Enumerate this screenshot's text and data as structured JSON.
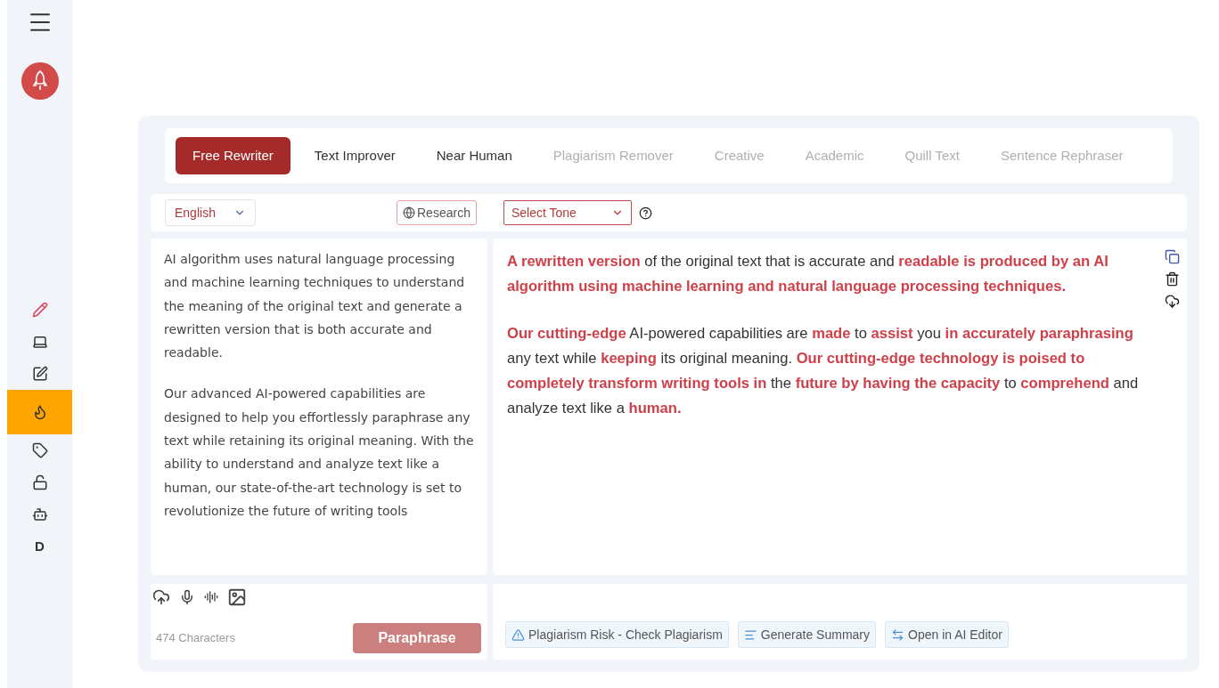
{
  "sidebar": {
    "items": [
      {
        "kind": "pencil",
        "selected": false
      },
      {
        "kind": "laptop",
        "selected": false
      },
      {
        "kind": "edit",
        "selected": false
      },
      {
        "kind": "flame",
        "selected": true
      },
      {
        "kind": "tag",
        "selected": false
      },
      {
        "kind": "unlock",
        "selected": false
      },
      {
        "kind": "robot",
        "selected": false
      },
      {
        "kind": "letter",
        "label": "D",
        "selected": false
      }
    ]
  },
  "tabs": [
    {
      "label": "Free Rewriter",
      "selected": true,
      "disabled": false
    },
    {
      "label": "Text Improver",
      "selected": false,
      "disabled": false
    },
    {
      "label": "Near Human",
      "selected": false,
      "disabled": false
    },
    {
      "label": "Plagiarism Remover",
      "selected": false,
      "disabled": true
    },
    {
      "label": "Creative",
      "selected": false,
      "disabled": true
    },
    {
      "label": "Academic",
      "selected": false,
      "disabled": true
    },
    {
      "label": "Quill Text",
      "selected": false,
      "disabled": true
    },
    {
      "label": "Sentence Rephraser",
      "selected": false,
      "disabled": true
    }
  ],
  "toolbar": {
    "language": "English",
    "research_button": "Research",
    "tone": {
      "placeholder": "Select Tone"
    }
  },
  "input": {
    "paragraphs": [
      "AI algorithm uses natural language processing and machine learning techniques to understand the meaning of the original text and generate a rewritten version that is both accurate and readable.",
      "Our advanced AI-powered capabilities are designed to help you effortlessly paraphrase any text while retaining its original meaning. With the ability to understand and analyze text like a human, our state-of-the-art technology is set to revolutionize the future of writing tools"
    ],
    "character_count": "474 Characters",
    "paraphrase_button": "Paraphrase"
  },
  "output": {
    "paragraphs": [
      [
        {
          "text": "A rewritten version",
          "changed": true
        },
        {
          "text": " of the original text that is accurate and ",
          "changed": false
        },
        {
          "text": "readable is produced by an AI algorithm using machine learning and natural language processing techniques.",
          "changed": true
        }
      ],
      [
        {
          "text": "Our cutting-edge",
          "changed": true
        },
        {
          "text": " AI-powered capabilities are ",
          "changed": false
        },
        {
          "text": "made",
          "changed": true
        },
        {
          "text": " to ",
          "changed": false
        },
        {
          "text": "assist",
          "changed": true
        },
        {
          "text": " you ",
          "changed": false
        },
        {
          "text": "in accurately paraphrasing",
          "changed": true
        },
        {
          "text": " any text while ",
          "changed": false
        },
        {
          "text": "keeping",
          "changed": true
        },
        {
          "text": " its original meaning. ",
          "changed": false
        },
        {
          "text": "Our cutting-edge technology is poised to completely transform writing tools in",
          "changed": true
        },
        {
          "text": " the ",
          "changed": false
        },
        {
          "text": "future by having the capacity",
          "changed": true
        },
        {
          "text": " to ",
          "changed": false
        },
        {
          "text": "comprehend",
          "changed": true
        },
        {
          "text": " and analyze text like a ",
          "changed": false
        },
        {
          "text": "human.",
          "changed": true
        }
      ]
    ]
  },
  "actions": [
    "Plagiarism Risk - Check Plagiarism",
    "Generate Summary",
    "Open in AI Editor"
  ]
}
